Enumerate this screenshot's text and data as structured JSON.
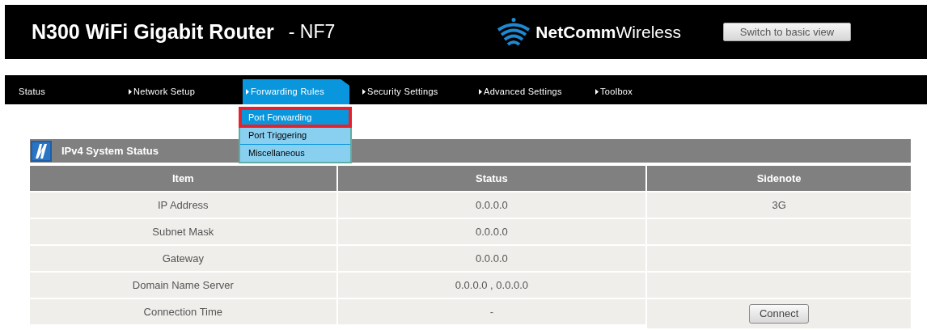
{
  "header": {
    "title": "N300 WiFi Gigabit Router",
    "model": "- NF7",
    "brand": {
      "bold": "NetComm",
      "light": "Wireless"
    },
    "switch_button": "Switch to basic view"
  },
  "nav": [
    {
      "label": "Status",
      "arrow": false,
      "selected": false
    },
    {
      "label": "Network Setup",
      "arrow": true,
      "selected": false
    },
    {
      "label": "Forwarding Rules",
      "arrow": true,
      "selected": true,
      "submenu": [
        {
          "label": "Port Forwarding",
          "selected": true
        },
        {
          "label": "Port Triggering",
          "selected": false
        },
        {
          "label": "Miscellaneous",
          "selected": false
        }
      ]
    },
    {
      "label": "Security Settings",
      "arrow": true,
      "selected": false
    },
    {
      "label": "Advanced Settings",
      "arrow": true,
      "selected": false
    },
    {
      "label": "Toolbox",
      "arrow": true,
      "selected": false
    }
  ],
  "panel": {
    "title": "IPv4 System Status",
    "columns": [
      "Item",
      "Status",
      "Sidenote"
    ],
    "rows": [
      {
        "item": "IP Address",
        "status": "0.0.0.0",
        "sidenote": {
          "kind": "text",
          "text": "3G"
        }
      },
      {
        "item": "Subnet Mask",
        "status": "0.0.0.0"
      },
      {
        "item": "Gateway",
        "status": "0.0.0.0"
      },
      {
        "item": "Domain Name Server",
        "status": "0.0.0.0 , 0.0.0.0"
      },
      {
        "item": "Connection Time",
        "status": "-",
        "sidenote": {
          "kind": "button",
          "text": "Connect"
        }
      }
    ]
  }
}
